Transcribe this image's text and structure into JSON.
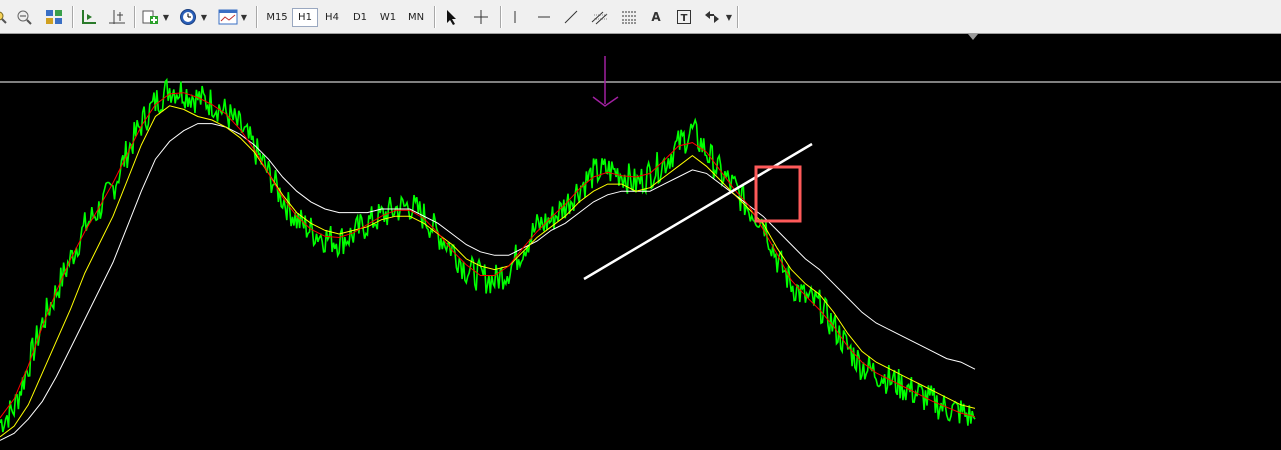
{
  "toolbar": {
    "timeframes": [
      {
        "label": "M15",
        "active": false
      },
      {
        "label": "H1",
        "active": true
      },
      {
        "label": "H4",
        "active": false
      },
      {
        "label": "D1",
        "active": false
      },
      {
        "label": "W1",
        "active": false
      },
      {
        "label": "MN",
        "active": false
      }
    ],
    "text_tool_label": "A",
    "text_label_tool_glyph": "T"
  },
  "chart": {
    "background": "#000000",
    "price_color": "#00ff00",
    "ma_fast_color": "#ff0000",
    "ma_mid_color": "#ffff00",
    "ma_slow_color": "#ffffff",
    "trendline_color": "#ffffff",
    "highlight_box_color": "#ff5a5a",
    "arrow_color": "#a020a0"
  },
  "chart_data": {
    "type": "line",
    "xlabel": "",
    "ylabel": "",
    "grid": false,
    "series": [
      {
        "values": [
          6,
          10,
          22,
          34,
          43,
          52,
          61,
          66,
          72,
          82,
          90,
          96,
          100,
          99,
          97,
          96,
          93,
          89,
          83,
          76,
          69,
          63,
          60,
          58,
          57,
          59,
          62,
          64,
          66,
          67,
          64,
          59,
          55,
          49,
          47,
          46,
          49,
          55,
          61,
          63,
          67,
          72,
          76,
          77,
          76,
          73,
          76,
          79,
          84,
          88,
          82,
          76,
          72,
          66,
          63,
          52,
          45,
          41,
          39,
          33,
          27,
          22,
          20,
          18,
          16,
          14,
          12,
          10,
          9,
          7
        ]
      },
      {
        "values": [
          2,
          5,
          11,
          20,
          29,
          38,
          48,
          56,
          64,
          74,
          84,
          92,
          95,
          94,
          92,
          91,
          89,
          86,
          82,
          76,
          70,
          65,
          62,
          60,
          59,
          60,
          61,
          63,
          64,
          64,
          62,
          59,
          56,
          52,
          50,
          49,
          50,
          54,
          58,
          61,
          64,
          68,
          71,
          73,
          73,
          71,
          72,
          75,
          78,
          81,
          78,
          74,
          70,
          66,
          62,
          55,
          49,
          45,
          42,
          37,
          31,
          26,
          23,
          21,
          19,
          17,
          15,
          13,
          11,
          10
        ]
      },
      {
        "values": [
          1,
          3,
          7,
          12,
          19,
          27,
          35,
          43,
          51,
          61,
          71,
          80,
          85,
          88,
          90,
          90,
          89,
          87,
          84,
          80,
          75,
          71,
          68,
          66,
          65,
          65,
          65,
          66,
          66,
          66,
          64,
          62,
          59,
          56,
          54,
          53,
          53,
          55,
          57,
          60,
          62,
          65,
          68,
          70,
          71,
          71,
          71,
          73,
          75,
          77,
          76,
          73,
          70,
          67,
          64,
          60,
          56,
          52,
          49,
          45,
          41,
          37,
          34,
          32,
          30,
          28,
          26,
          24,
          23,
          21
        ]
      }
    ]
  }
}
